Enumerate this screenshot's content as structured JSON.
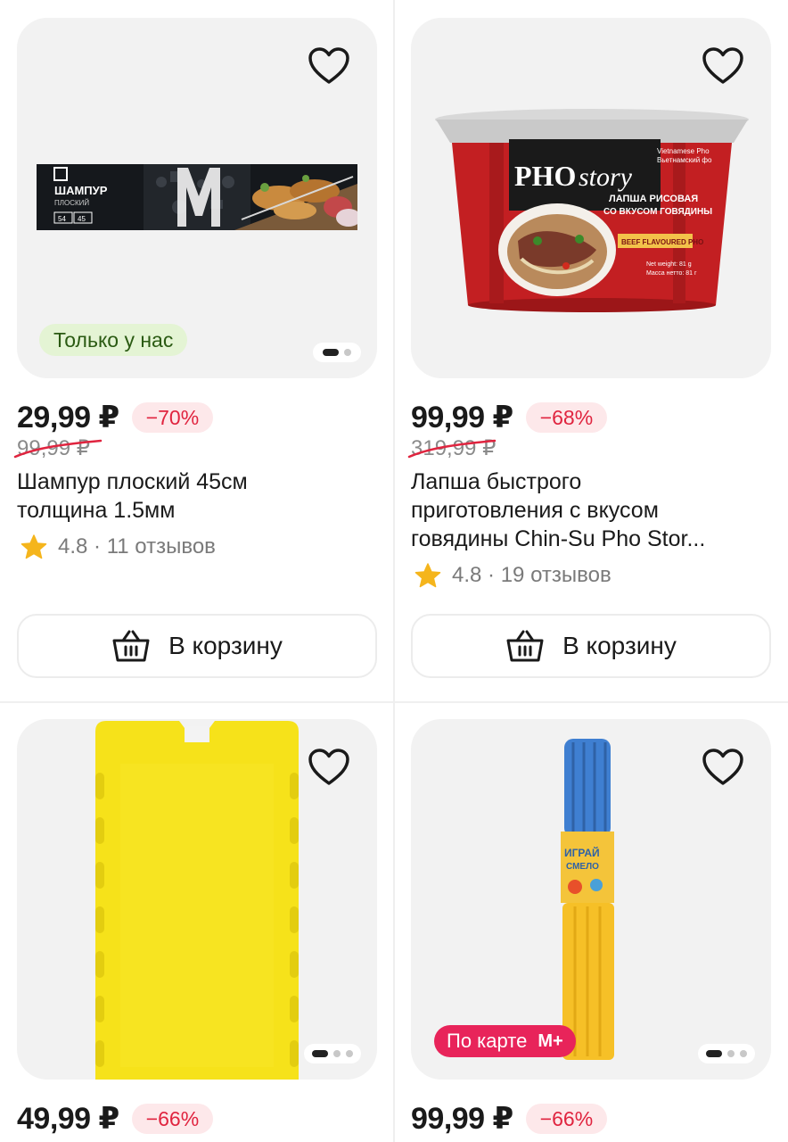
{
  "products": [
    {
      "price": "29,99 ₽",
      "discount": "−70%",
      "old_price": "99,99 ₽",
      "title_lines": [
        "Шампур плоский 45см",
        "толщина 1.5мм"
      ],
      "rating": "4.8",
      "reviews": "11 отзывов",
      "badge": "Только у нас",
      "cart_label": "В корзину",
      "image_icon": "skewer-package-image",
      "package_text": {
        "title": "ШАМПУР",
        "subtitle": "ПЛОСКИЙ",
        "size1": "54",
        "size2": "45"
      }
    },
    {
      "price": "99,99 ₽",
      "discount": "−68%",
      "old_price": "319,99 ₽",
      "title_lines": [
        "Лапша быстрого",
        "приготовления с вкусом",
        "говядины Chin-Su Pho Stor..."
      ],
      "rating": "4.8",
      "reviews": "19 отзывов",
      "cart_label": "В корзину",
      "image_icon": "noodle-bowl-image",
      "package_text": {
        "brand_a": "PHO",
        "brand_b": "story",
        "line1": "ЛАПША РИСОВАЯ",
        "line2": "СО ВКУСОМ ГОВЯДИНЫ",
        "tag": "BEEF FLAVOURED PHO",
        "side1": "Vietnamese Pho",
        "side2": "Вьетнамский фо",
        "w1": "Net weight: 81 g",
        "w2": "Масса нетто: 81 г"
      }
    },
    {
      "price": "49,99 ₽",
      "discount": "−66%",
      "image_icon": "yellow-ice-pack-image"
    },
    {
      "price": "99,99 ₽",
      "discount": "−66%",
      "badge": "По карте",
      "badge_suffix": "M+",
      "image_icon": "water-blaster-toy-image",
      "package_text": {
        "label1": "ИГРАЙ",
        "label2": "СМЕЛО"
      }
    }
  ],
  "colors": {
    "accent_red": "#e0243f",
    "discount_bg": "#fde8ea",
    "badge_green_bg": "#e4f4d4",
    "badge_card_bg": "#e8245a",
    "star": "#f5b51c"
  }
}
